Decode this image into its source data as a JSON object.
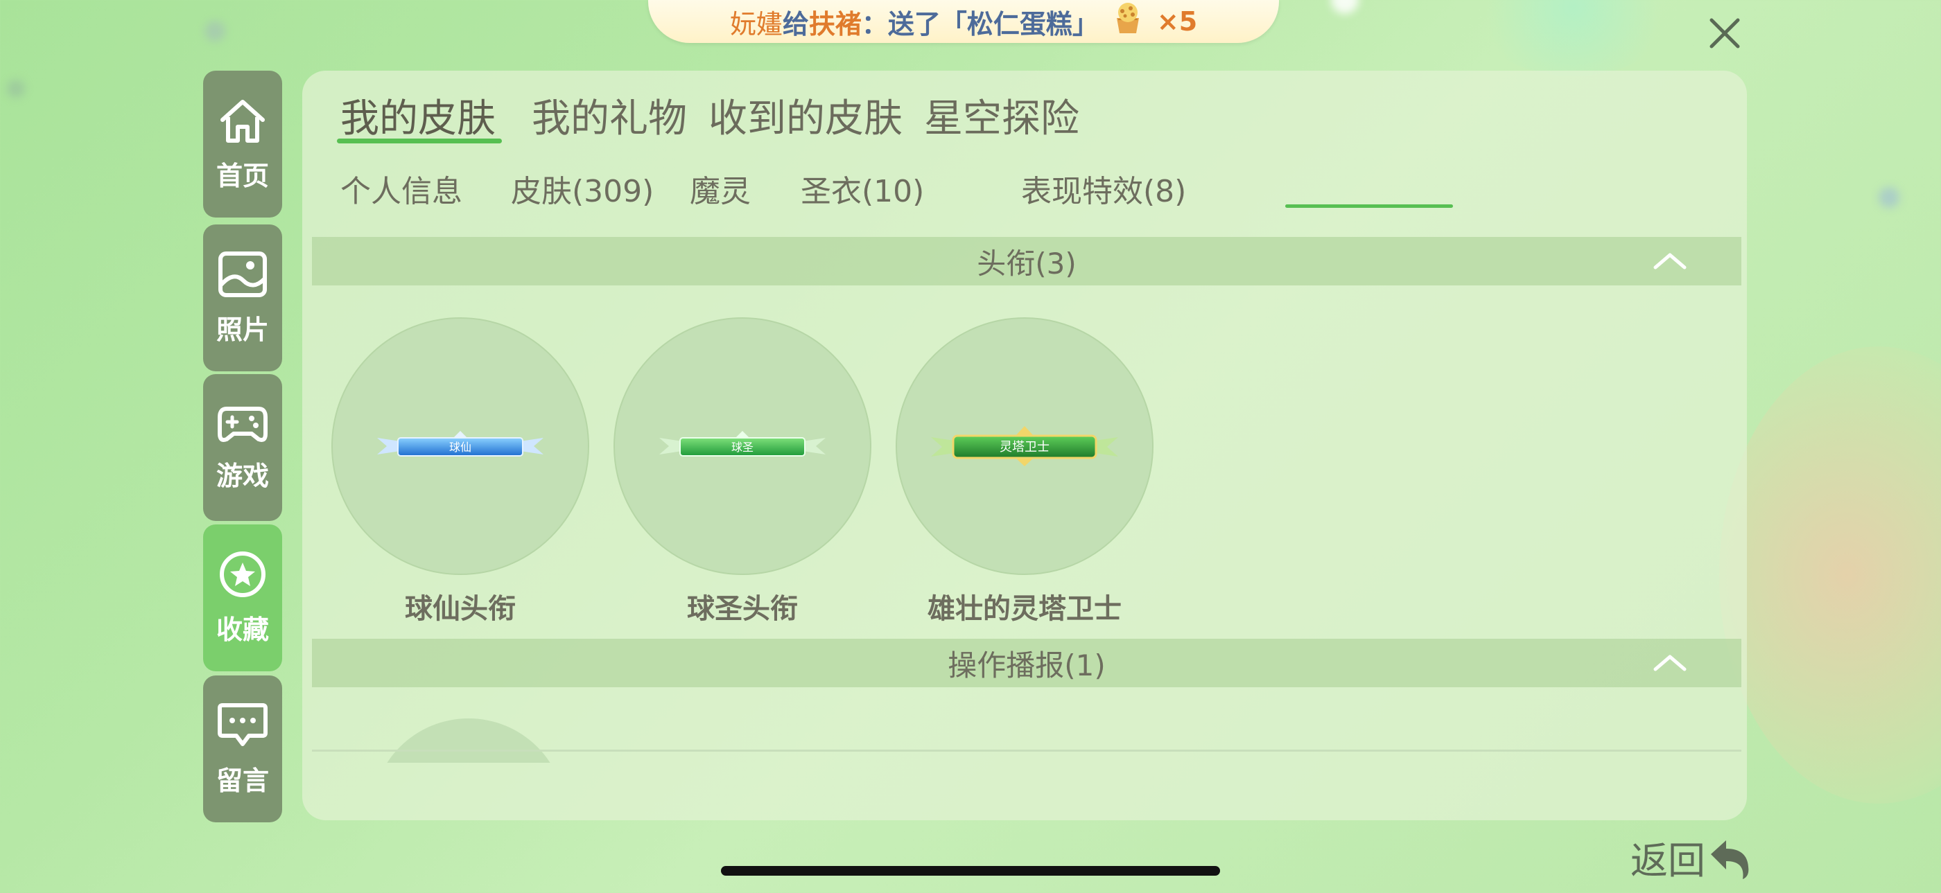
{
  "banner": {
    "sender": "妧嫿",
    "gave_word": "给",
    "receiver": "扶褚",
    "message": "：送了「松仁蛋糕」",
    "gift_icon": "cupcake-icon",
    "count": "×5"
  },
  "sidebar": {
    "items": [
      {
        "label": "首页",
        "icon": "home-icon"
      },
      {
        "label": "照片",
        "icon": "photo-icon"
      },
      {
        "label": "游戏",
        "icon": "gamepad-icon"
      },
      {
        "label": "收藏",
        "icon": "star-icon",
        "active": true
      },
      {
        "label": "留言",
        "icon": "message-icon"
      }
    ]
  },
  "tabs": [
    {
      "label": "我的皮肤",
      "active": true
    },
    {
      "label": "我的礼物"
    },
    {
      "label": "收到的皮肤"
    },
    {
      "label": "星空探险"
    }
  ],
  "subtabs": [
    {
      "label": "个人信息"
    },
    {
      "label": "皮肤(309)"
    },
    {
      "label": "魔灵"
    },
    {
      "label": "圣衣(10)"
    },
    {
      "label": "表现特效(8)",
      "active": true
    }
  ],
  "sections": [
    {
      "title": "头衔(3)",
      "items": [
        {
          "label": "球仙头衔",
          "badge_text": "球仙",
          "badge_color": "#3a8fe0"
        },
        {
          "label": "球圣头衔",
          "badge_text": "球圣",
          "badge_color": "#34b04a"
        },
        {
          "label": "雄壮的灵塔卫士",
          "badge_text": "灵塔卫士",
          "badge_color": "#2f9a3a"
        }
      ]
    },
    {
      "title": "操作播报(1)"
    }
  ],
  "back": {
    "label": "返回"
  },
  "colors": {
    "accent": "#57bf52",
    "sidebar_bg": "#7d9570",
    "sidebar_active": "#7bcf6c",
    "banner_name": "#e07b2c"
  }
}
